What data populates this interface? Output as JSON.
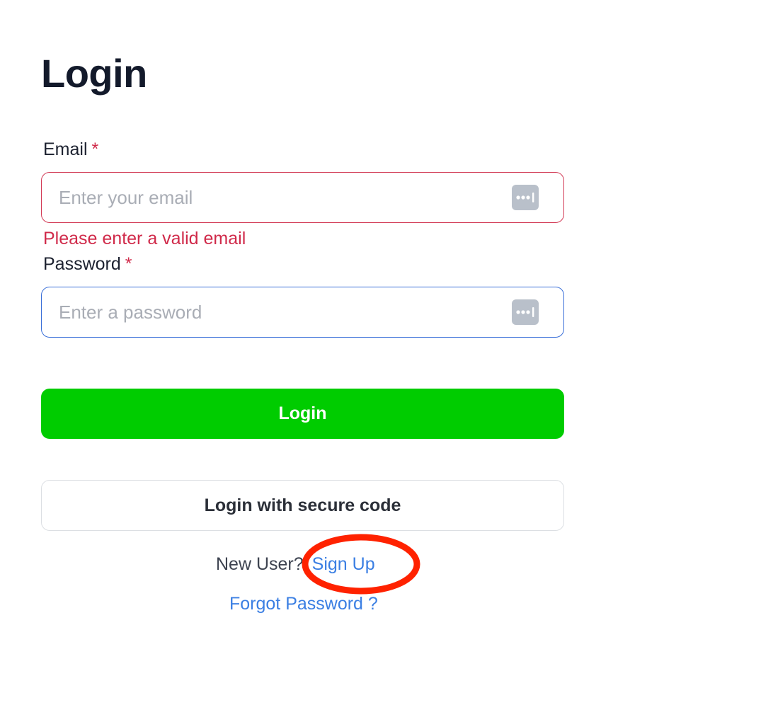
{
  "page": {
    "title": "Login"
  },
  "form": {
    "email": {
      "label": "Email",
      "required_mark": "*",
      "value": "",
      "placeholder": "Enter your email",
      "error": "Please enter a valid email",
      "state": "invalid"
    },
    "password": {
      "label": "Password",
      "required_mark": "*",
      "value": "",
      "placeholder": "Enter a password",
      "state": "focused"
    },
    "login_button": "Login",
    "secure_code_button": "Login with secure code"
  },
  "footer": {
    "new_user_text": "New User?",
    "signup_link": "Sign Up",
    "forgot_password_link": "Forgot Password ?"
  },
  "annotation": {
    "shape": "ellipse",
    "target": "signup_link",
    "color": "#ff2200"
  },
  "icons": {
    "field_autofill": "password-manager-icon"
  },
  "colors": {
    "primary_button": "#00cc00",
    "link": "#3b7fe3",
    "error": "#d02a4a",
    "focus_border": "#3a6fd8"
  }
}
